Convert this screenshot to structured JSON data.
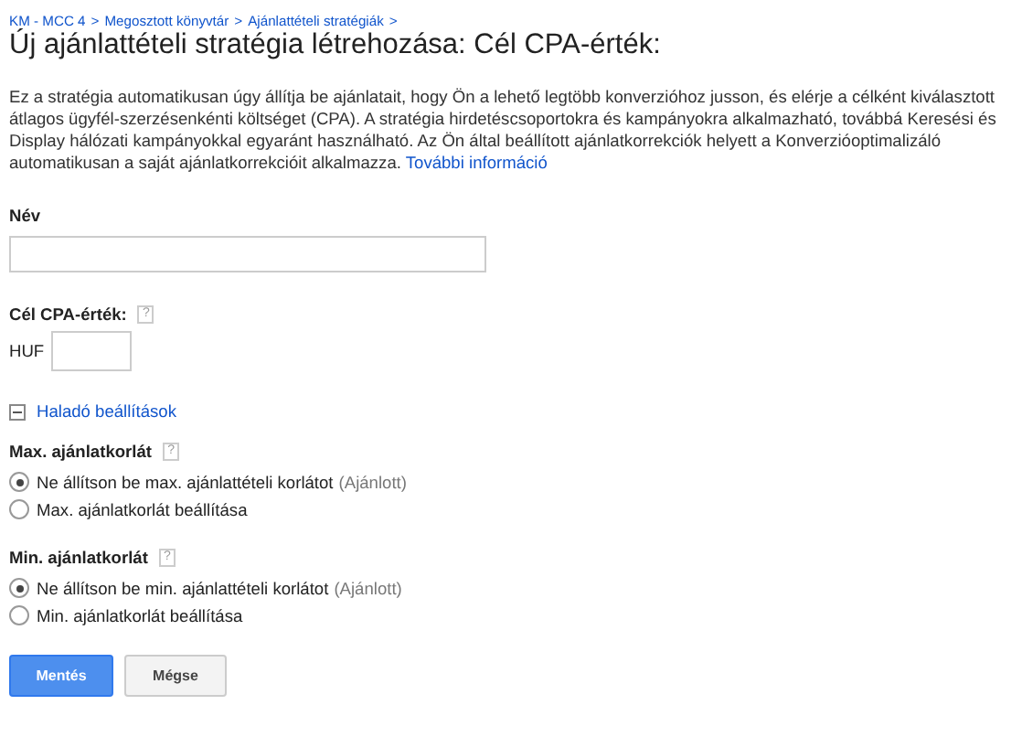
{
  "breadcrumb": [
    {
      "label": "KM - MCC 4",
      "sep": ">"
    },
    {
      "label": "Megosztott könyvtár",
      "sep": ">"
    },
    {
      "label": "Ajánlattételi stratégiák",
      "sep": ">"
    }
  ],
  "title": "Új ajánlattételi stratégia létrehozása: Cél CPA-érték:",
  "description": "Ez a stratégia automatikusan úgy állítja be ajánlatait, hogy Ön a lehető legtöbb konverzióhoz jusson, és elérje a célként kiválasztott átlagos ügyfél-szerzésenkénti költséget (CPA). A stratégia hirdetéscsoportokra és kampányokra alkalmazható, továbbá Keresési és Display hálózati kampányokkal egyaránt használható. Az Ön által beállított ajánlatkorrekciók helyett a Konverzióoptimalizáló automatikusan a saját ajánlatkorrekcióit alkalmazza.",
  "more_link": "További információ",
  "name_field": {
    "label": "Név"
  },
  "cpa_field": {
    "label": "Cél CPA-érték:",
    "help": "?",
    "currency": "HUF"
  },
  "advanced": {
    "label": "Haladó beállítások",
    "expanded": true
  },
  "groups": [
    {
      "label": "Max. ajánlatkorlát",
      "help": "?",
      "options": [
        {
          "label": "Ne állítson be max. ajánlattételi korlátot",
          "note": "(Ajánlott)",
          "selected": true
        },
        {
          "label": "Max. ajánlatkorlát beállítása",
          "selected": false
        }
      ]
    },
    {
      "label": "Min. ajánlatkorlát",
      "help": "?",
      "options": [
        {
          "label": "Ne állítson be min. ajánlattételi korlátot",
          "note": "(Ajánlott)",
          "selected": true
        },
        {
          "label": "Min. ajánlatkorlát beállítása",
          "selected": false
        }
      ]
    }
  ],
  "buttons": [
    {
      "label": "Mentés",
      "kind": "primary"
    },
    {
      "label": "Mégse",
      "kind": "secondary"
    }
  ]
}
